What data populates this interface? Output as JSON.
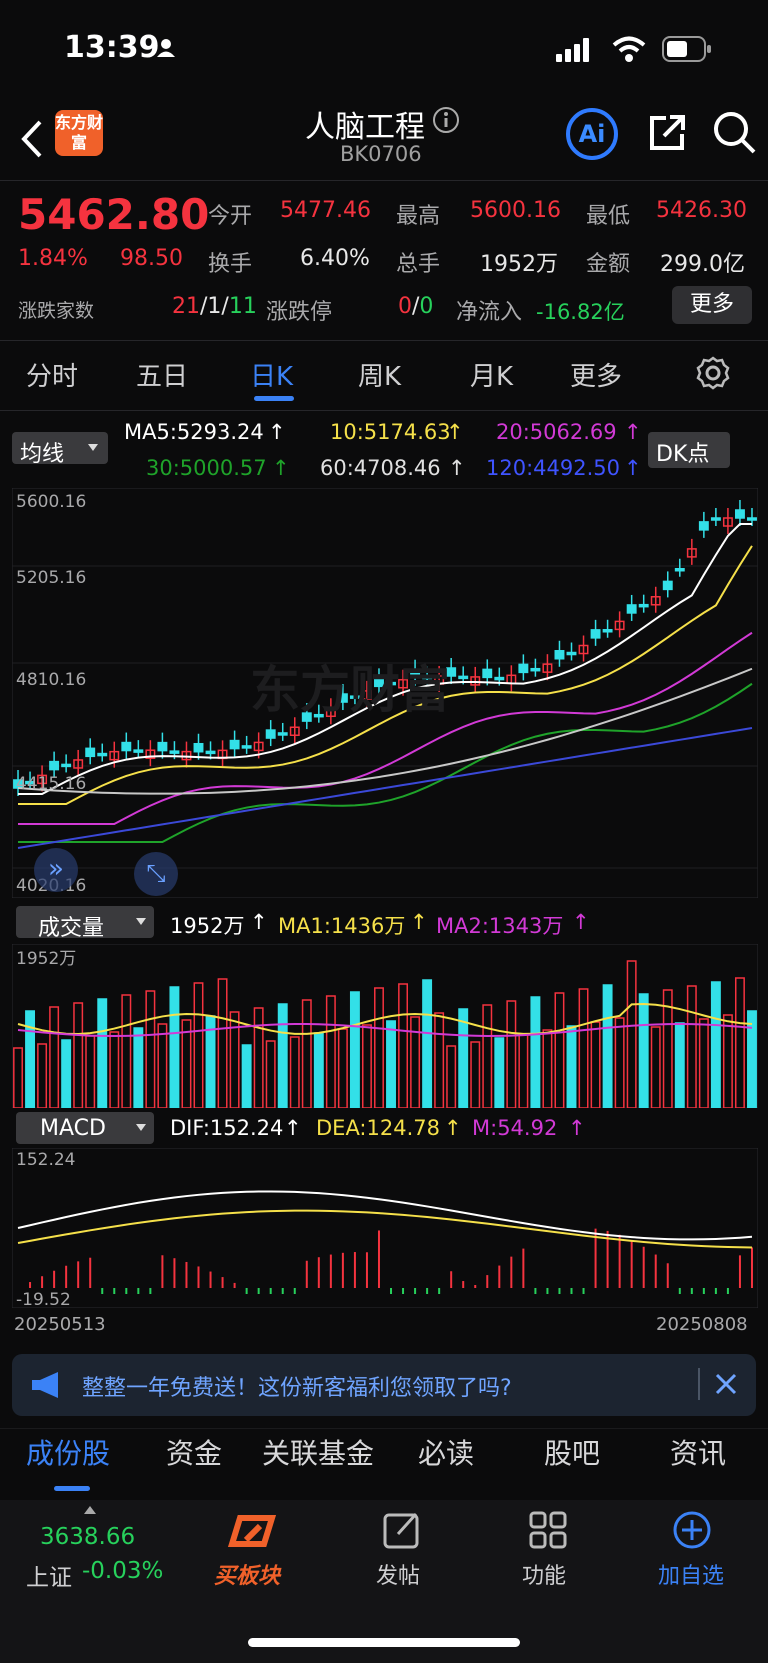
{
  "status": {
    "time": "13:39"
  },
  "header": {
    "logo": "东方财富",
    "title": "人脑工程",
    "code": "BK0706",
    "ai_label": "Ai"
  },
  "quote": {
    "price": "5462.80",
    "pct": "1.84%",
    "chg": "98.50",
    "open_l": "今开",
    "open": "5477.46",
    "high_l": "最高",
    "high": "5600.16",
    "low_l": "最低",
    "low": "5426.30",
    "turn_l": "换手",
    "turn": "6.40%",
    "vol_l": "总手",
    "vol": "1952万",
    "amt_l": "金额",
    "amt": "299.0亿",
    "breadth_l": "涨跌家数",
    "b_up": "21",
    "b_sep1": "/",
    "b_flat": "1",
    "b_sep2": "/",
    "b_down": "11",
    "limit_l": "涨跌停",
    "lim_up": "0",
    "lim_sep": "/",
    "lim_down": "0",
    "flow_l": "净流入",
    "flow": "-16.82亿",
    "more": "更多"
  },
  "tabs": [
    "分时",
    "五日",
    "日K",
    "周K",
    "月K",
    "更多"
  ],
  "ma": {
    "selector": "均线",
    "ma5": "MA5:5293.24",
    "ma10": "10:5174.63",
    "ma20": "20:5062.69",
    "ma30": "30:5000.57",
    "ma60": "60:4708.46",
    "ma120": "120:4492.50",
    "dk": "DK点"
  },
  "axis": {
    "p1": "5600.16",
    "p2": "5205.16",
    "p3": "4810.16",
    "p4": "4415.16",
    "p5": "4020.16",
    "watermark": "东方财富"
  },
  "volume": {
    "selector": "成交量",
    "val": "1952万",
    "ma1": "MA1:1436万",
    "ma2": "MA2:1343万",
    "top": "1952万"
  },
  "macd": {
    "selector": "MACD",
    "dif": "DIF:152.24",
    "dea": "DEA:124.78",
    "m": "M:54.92",
    "top": "152.24",
    "bottom": "-19.52"
  },
  "dates": {
    "start": "20250513",
    "end": "20250808"
  },
  "banner": {
    "text": "整整一年免费送！这份新客福利您领取了吗?"
  },
  "bottom_tabs": [
    "成份股",
    "资金",
    "关联基金",
    "必读",
    "股吧",
    "资讯"
  ],
  "nav": {
    "index_val": "3638.66",
    "index_name": "上证",
    "index_pct": "-0.03%",
    "buy": "买板块",
    "post": "发帖",
    "func": "功能",
    "add": "加自选"
  },
  "colors": {
    "up": "#f5333f",
    "down": "#27d15c",
    "accent": "#3b82f6",
    "ma5": "#ffffff",
    "ma10": "#f5e04a",
    "ma20": "#d23ad6",
    "ma30": "#1fa32a",
    "ma60": "#c8c8c8",
    "ma120": "#3b49d8",
    "candle_down": "#33e0e8"
  }
}
